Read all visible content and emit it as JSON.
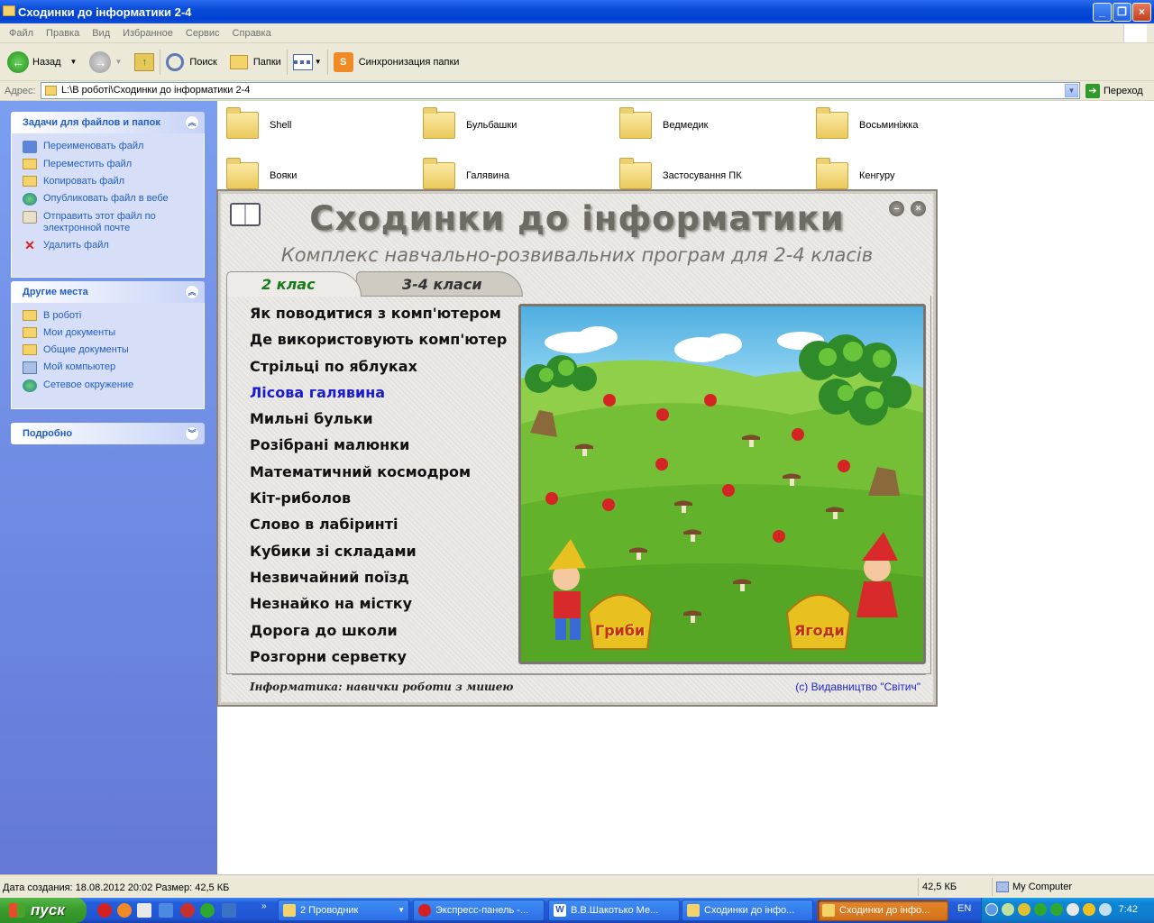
{
  "window": {
    "title": "Сходинки до інформатики 2-4"
  },
  "menubar": [
    "Файл",
    "Правка",
    "Вид",
    "Избранное",
    "Сервис",
    "Справка"
  ],
  "toolbar": {
    "back": "Назад",
    "search": "Поиск",
    "folders": "Папки",
    "sync": "Синхронизация папки"
  },
  "address": {
    "label": "Адрес:",
    "path": "L:\\В роботі\\Сходинки до інформатики 2-4",
    "go": "Переход"
  },
  "sidebar": {
    "tasks_title": "Задачи для файлов и папок",
    "tasks": [
      "Переименовать файл",
      "Переместить файл",
      "Копировать файл",
      "Опубликовать файл в вебе",
      "Отправить этот файл по электронной почте",
      "Удалить файл"
    ],
    "places_title": "Другие места",
    "places": [
      "В роботі",
      "Мои документы",
      "Общие документы",
      "Мой компьютер",
      "Сетевое окружение"
    ],
    "details_title": "Подробно"
  },
  "folders": [
    "Shell",
    "Бульбашки",
    "Ведмедик",
    "Восьминіжка",
    "Вояки",
    "Галявина",
    "Застосування ПК",
    "Кенгуру"
  ],
  "app": {
    "title": "Сходинки до інформатики",
    "subtitle": "Комплекс навчально-розвивальних програм для 2-4 класів",
    "tabs": [
      "2 клас",
      "3-4 класи"
    ],
    "items": [
      "Як поводитися з комп'ютером",
      "Де використовують комп'ютер",
      "Стрільці по яблуках",
      "Лісова галявина",
      "Мильні бульки",
      "Розібрані малюнки",
      "Математичний космодром",
      "Кіт-риболов",
      "Слово в лабіринті",
      "Кубики зі складами",
      "Незвичайний поїзд",
      "Незнайко на містку",
      "Дорога до школи",
      "Розгорни серветку"
    ],
    "active_item": "Лісова галявина",
    "basket_left": "Гриби",
    "basket_right": "Ягоди",
    "footer_left": "Інформатика: навички роботи з мишею",
    "footer_right": "(с) Видавництво \"Світич\""
  },
  "status": {
    "info": "Дата создания: 18.08.2012 20:02 Размер: 42,5 КБ",
    "size": "42,5 КБ",
    "location": "My Computer"
  },
  "taskbar": {
    "start": "пуск",
    "tasks": [
      "2 Проводник",
      "Экспресс-панель -...",
      "В.В.Шакотько Ме...",
      "Сходинки до інфо...",
      "Сходинки до інфо..."
    ],
    "lang": "EN",
    "clock": "7:42"
  },
  "colors": {
    "xp_blue": "#0a4bd8",
    "sidebar_link": "#215dc6",
    "active_menu": "#1a1ad0",
    "tab_green": "#1a7a1a"
  }
}
